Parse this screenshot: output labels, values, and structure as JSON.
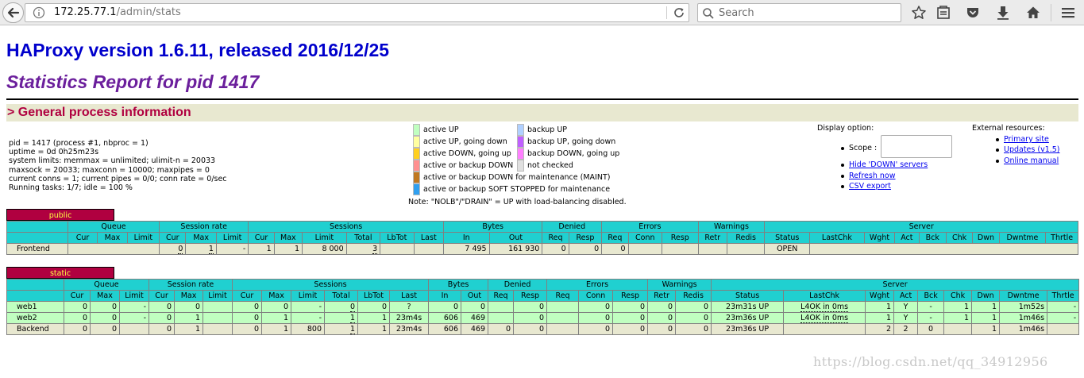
{
  "browser": {
    "url_host": "172.25.77.1",
    "url_path": "/admin/stats",
    "search_placeholder": "Search"
  },
  "page": {
    "title": "HAProxy version 1.6.11, released 2016/12/25",
    "subtitle": "Statistics Report for pid 1417",
    "section": "> General process information"
  },
  "process_info": [
    "pid = 1417 (process #1, nbproc = 1)",
    "uptime = 0d 0h25m23s",
    "system limits: memmax = unlimited; ulimit-n = 20033",
    "maxsock = 20033; maxconn = 10000; maxpipes = 0",
    "current conns = 1; current pipes = 0/0; conn rate = 0/sec",
    "Running tasks: 1/7; idle = 100 %"
  ],
  "legend": {
    "left": [
      {
        "color": "#c0ffc0",
        "label": "active UP"
      },
      {
        "color": "#ffffa0",
        "label": "active UP, going down"
      },
      {
        "color": "#ffd020",
        "label": "active DOWN, going up"
      },
      {
        "color": "#ff9090",
        "label": "active or backup DOWN"
      },
      {
        "color": "#c07820",
        "label": "active or backup DOWN for maintenance (MAINT)"
      },
      {
        "color": "#30a0f0",
        "label": "active or backup SOFT STOPPED for maintenance"
      }
    ],
    "right": [
      {
        "color": "#b0d0ff",
        "label": "backup UP"
      },
      {
        "color": "#c060ff",
        "label": "backup UP, going down"
      },
      {
        "color": "#ff80ff",
        "label": "backup DOWN, going up"
      },
      {
        "color": "#e0e0e0",
        "label": "not checked"
      }
    ],
    "note": "Note: \"NOLB\"/\"DRAIN\" = UP with load-balancing disabled."
  },
  "display_option": {
    "title": "Display option:",
    "scope_label": "Scope :",
    "links": [
      "Hide 'DOWN' servers",
      "Refresh now",
      "CSV export"
    ]
  },
  "external": {
    "title": "External resources:",
    "links": [
      "Primary site",
      "Updates (v1.5)",
      "Online manual"
    ]
  },
  "groups": {
    "queue": "Queue",
    "session_rate": "Session rate",
    "sessions": "Sessions",
    "bytes": "Bytes",
    "denied": "Denied",
    "errors": "Errors",
    "warnings": "Warnings",
    "server": "Server"
  },
  "public": {
    "name": "public",
    "headers": [
      "",
      "Cur",
      "Max",
      "Limit",
      "Cur",
      "Max",
      "Limit",
      "Cur",
      "Max",
      "Limit",
      "Total",
      "LbTot",
      "Last",
      "In",
      "Out",
      "Req",
      "Resp",
      "Req",
      "Conn",
      "Resp",
      "Retr",
      "Redis",
      "Status",
      "LastChk",
      "Wght",
      "Act",
      "Bck",
      "Chk",
      "Dwn",
      "Dwntme",
      "Thrtle"
    ],
    "frontend": {
      "name": "Frontend",
      "sr_cur": "0",
      "sr_max": "1",
      "sr_lim": "-",
      "s_cur": "1",
      "s_max": "1",
      "s_lim": "8 000",
      "s_tot": "3",
      "b_in": "7 495",
      "b_out": "161 930",
      "d_req": "0",
      "d_resp": "0",
      "e_req": "0",
      "status": "OPEN"
    }
  },
  "static": {
    "name": "static",
    "headers": [
      "",
      "Cur",
      "Max",
      "Limit",
      "Cur",
      "Max",
      "Limit",
      "Cur",
      "Max",
      "Limit",
      "Total",
      "LbTot",
      "Last",
      "In",
      "Out",
      "Req",
      "Resp",
      "Req",
      "Conn",
      "Resp",
      "Retr",
      "Redis",
      "Status",
      "LastChk",
      "Wght",
      "Act",
      "Bck",
      "Chk",
      "Dwn",
      "Dwntme",
      "Thrtle"
    ],
    "web1": [
      "web1",
      "0",
      "0",
      "-",
      "0",
      "0",
      "",
      "0",
      "0",
      "-",
      "0",
      "0",
      "?",
      "0",
      "0",
      "",
      "0",
      "",
      "0",
      "0",
      "0",
      "0",
      "23m31s UP",
      "L4OK in 0ms",
      "1",
      "Y",
      "-",
      "1",
      "1",
      "1m52s",
      "-"
    ],
    "web2": [
      "web2",
      "0",
      "0",
      "-",
      "0",
      "1",
      "",
      "0",
      "1",
      "-",
      "1",
      "1",
      "23m4s",
      "606",
      "469",
      "",
      "0",
      "",
      "0",
      "0",
      "0",
      "0",
      "23m36s UP",
      "L4OK in 0ms",
      "1",
      "Y",
      "-",
      "1",
      "1",
      "1m46s",
      "-"
    ],
    "backend": [
      "Backend",
      "0",
      "0",
      "",
      "0",
      "1",
      "",
      "0",
      "1",
      "800",
      "1",
      "1",
      "23m4s",
      "606",
      "469",
      "0",
      "0",
      "",
      "0",
      "0",
      "0",
      "0",
      "23m36s UP",
      "",
      "2",
      "2",
      "0",
      "",
      "1",
      "1m46s",
      ""
    ]
  },
  "watermark": "https://blog.csdn.net/qq_34912956"
}
